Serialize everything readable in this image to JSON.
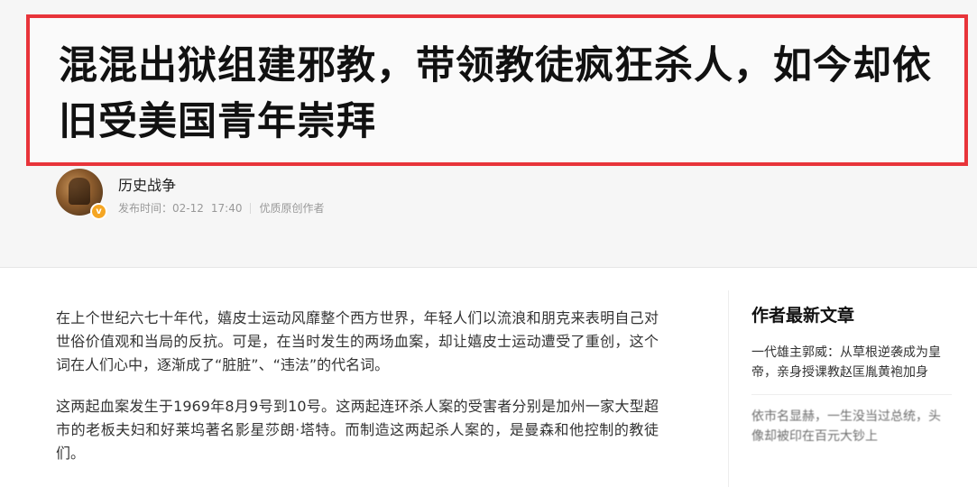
{
  "article": {
    "title": "混混出狱组建邪教，带领教徒疯狂杀人，如今却依旧受美国青年崇拜",
    "author": {
      "name": "历史战争",
      "avatar_icon": "author-avatar",
      "verified_icon": "verified-v-icon"
    },
    "meta": {
      "publish_label": "发布时间：02-12",
      "time": "17:40",
      "badge": "优质原创作者"
    },
    "paragraphs": [
      "在上个世纪六七十年代，嬉皮士运动风靡整个西方世界，年轻人们以流浪和朋克来表明自己对世俗价值观和当局的反抗。可是，在当时发生的两场血案，却让嬉皮士运动遭受了重创，这个词在人们心中，逐渐成了“脏脏”、“违法”的代名词。",
      "这两起血案发生于1969年8月9号到10号。这两起连环杀人案的受害者分别是加州一家大型超市的老板夫妇和好莱坞著名影星莎朗·塔特。而制造这两起杀人案的，是曼森和他控制的教徒们。"
    ]
  },
  "sidebar": {
    "title": "作者最新文章",
    "items": [
      "一代雄主郭威：从草根逆袭成为皇帝，亲身授课教赵匡胤黄袍加身",
      "依市名显赫，一生没当过总统，头像却被印在百元大钞上"
    ]
  },
  "colors": {
    "title_border": "#e8343a",
    "header_background": "#f6f6f6",
    "badge": "#f5a623"
  }
}
